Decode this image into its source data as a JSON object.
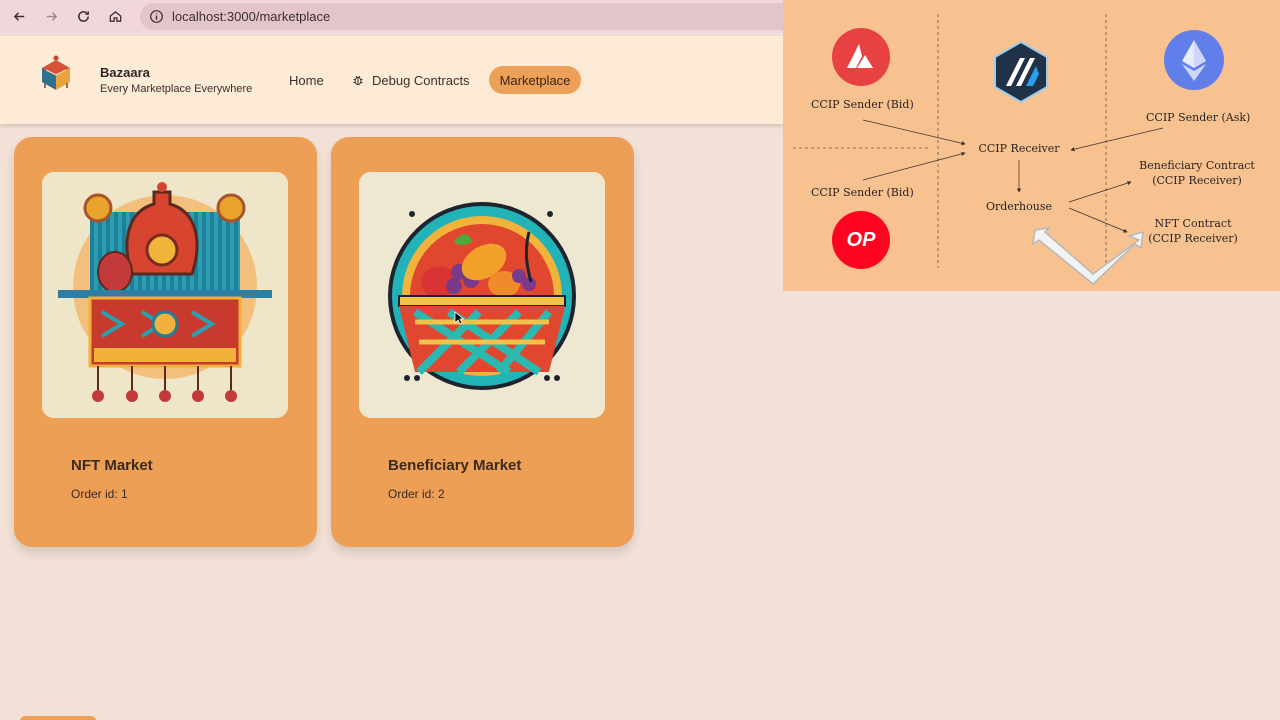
{
  "browser": {
    "url": "localhost:3000/marketplace",
    "icons": [
      "back-icon",
      "forward-icon",
      "reload-icon",
      "home-icon",
      "info-icon"
    ]
  },
  "header": {
    "brand_name": "Bazaara",
    "tagline": "Every Marketplace Everywhere",
    "nav": {
      "home": "Home",
      "debug": "Debug Contracts",
      "marketplace": "Marketplace"
    }
  },
  "cards": [
    {
      "title": "NFT Market",
      "order": "Order id: 1"
    },
    {
      "title": "Beneficiary Market",
      "order": "Order id: 2"
    }
  ],
  "diagram": {
    "sender_bid_top": "CCIP Sender (Bid)",
    "sender_bid_bottom": "CCIP Sender (Bid)",
    "sender_ask": "CCIP Sender (Ask)",
    "receiver": "CCIP Receiver",
    "orderhouse": "Orderhouse",
    "beneficiary_line1": "Beneficiary Contract",
    "beneficiary_line2": "(CCIP Receiver)",
    "nft_line1": "NFT Contract",
    "nft_line2": "(CCIP Receiver)",
    "op_logo_text": "OP",
    "colors": {
      "avalanche": "#e84142",
      "optimism": "#ff0420",
      "ethereum": "#627eea",
      "arbitrum": "#213147"
    }
  },
  "colors": {
    "accent": "#ed9f56",
    "background": "#f2e1d7",
    "header": "#fdebd6"
  }
}
